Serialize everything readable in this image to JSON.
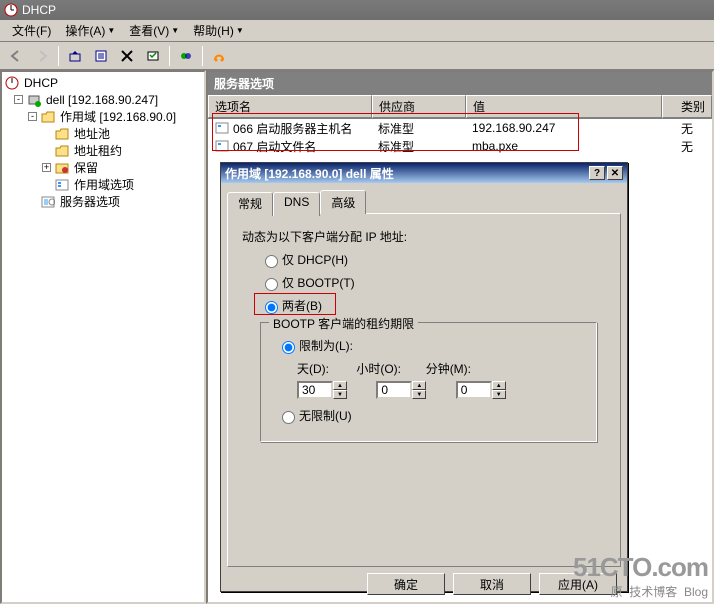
{
  "window": {
    "title": "DHCP"
  },
  "menu": {
    "file": "文件(F)",
    "action": "操作(A)",
    "view": "查看(V)",
    "help": "帮助(H)"
  },
  "tree": {
    "root": "DHCP",
    "server": "dell [192.168.90.247]",
    "scope": "作用域 [192.168.90.0]",
    "pool": "地址池",
    "leases": "地址租约",
    "reservations": "保留",
    "scope_options": "作用域选项",
    "server_options": "服务器选项"
  },
  "panel": {
    "title": "服务器选项",
    "headers": {
      "name": "选项名",
      "vendor": "供应商",
      "value": "值",
      "class": "类别"
    },
    "rows": [
      {
        "name": "066 启动服务器主机名",
        "vendor": "标准型",
        "value": "192.168.90.247",
        "class": "无"
      },
      {
        "name": "067 启动文件名",
        "vendor": "标准型",
        "value": "mba.pxe",
        "class": "无"
      }
    ]
  },
  "dialog": {
    "title": "作用域 [192.168.90.0] dell 属性",
    "tabs": {
      "general": "常规",
      "dns": "DNS",
      "advanced": "高级"
    },
    "dyn_label": "动态为以下客户端分配 IP 地址:",
    "radio_dhcp": "仅 DHCP(H)",
    "radio_bootp": "仅 BOOTP(T)",
    "radio_both": "两者(B)",
    "group_title": "BOOTP 客户端的租约期限",
    "radio_limit": "限制为(L):",
    "days_label": "天(D):",
    "hours_label": "小时(O):",
    "mins_label": "分钟(M):",
    "days": "30",
    "hours": "0",
    "mins": "0",
    "radio_unlimited": "无限制(U)",
    "ok": "确定",
    "cancel": "取消",
    "apply": "应用(A)"
  },
  "watermark": {
    "site": "51CTO.com",
    "sub": "技术博客",
    "tag": "Blog",
    "prefix": "原"
  }
}
